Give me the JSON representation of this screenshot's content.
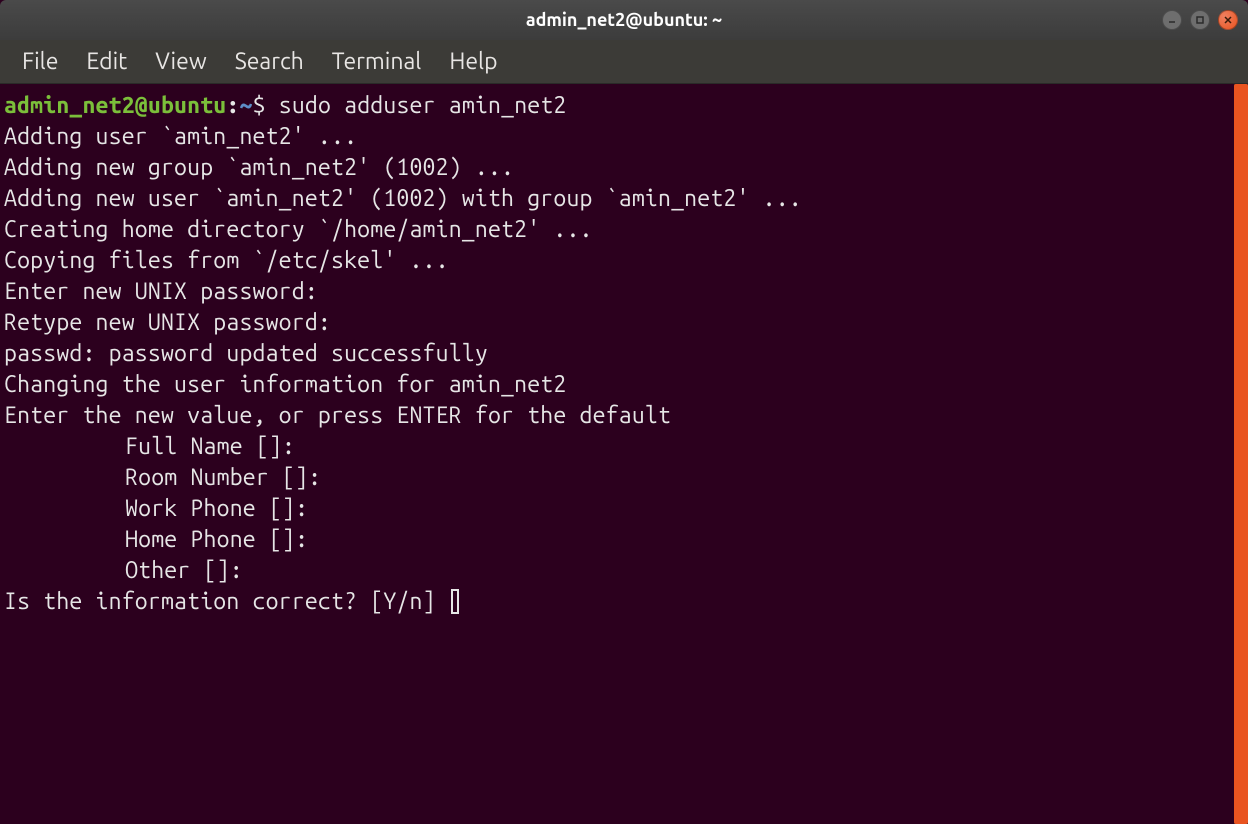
{
  "window": {
    "title": "admin_net2@ubuntu: ~"
  },
  "menubar": {
    "items": [
      "File",
      "Edit",
      "View",
      "Search",
      "Terminal",
      "Help"
    ]
  },
  "prompt": {
    "user_host": "admin_net2@ubuntu",
    "sep": ":",
    "path": "~",
    "symbol": "$"
  },
  "command": "sudo adduser amin_net2",
  "output": {
    "line1": "Adding user `amin_net2' ...",
    "line2": "Adding new group `amin_net2' (1002) ...",
    "line3": "Adding new user `amin_net2' (1002) with group `amin_net2' ...",
    "line4": "Creating home directory `/home/amin_net2' ...",
    "line5": "Copying files from `/etc/skel' ...",
    "line6": "Enter new UNIX password:",
    "line7": "Retype new UNIX password:",
    "line8": "passwd: password updated successfully",
    "line9": "Changing the user information for amin_net2",
    "line10": "Enter the new value, or press ENTER for the default",
    "field1": "Full Name []:",
    "field2": "Room Number []:",
    "field3": "Work Phone []:",
    "field4": "Home Phone []:",
    "field5": "Other []:",
    "confirm": "Is the information correct? [Y/n] "
  },
  "colors": {
    "bg": "#2c001e",
    "titlebar": "#3c3c3c",
    "menubar": "#3c3b37",
    "prompt_user": "#7bbf3a",
    "prompt_path": "#5e8dc7",
    "text": "#e6e6e6",
    "accent": "#e95420"
  }
}
